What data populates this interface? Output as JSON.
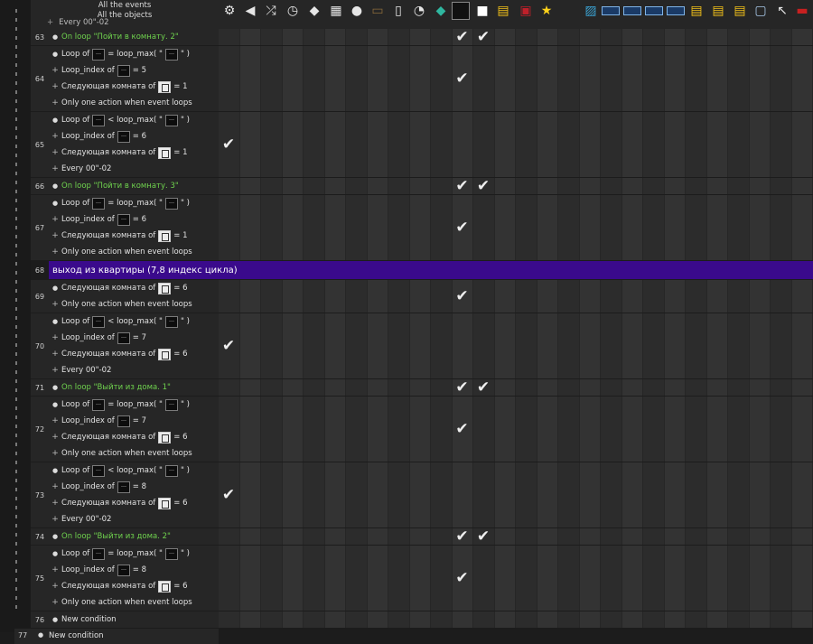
{
  "header": {
    "all_events": "All the events",
    "all_objects": "All the objects",
    "partial_row_text": "Every 00\"-02"
  },
  "icons": [
    "gears-icon",
    "speaker-icon",
    "shuffle-icon",
    "timer-icon",
    "eraser-icon",
    "keyboard-icon",
    "player-icon",
    "picture-icon",
    "door-icon",
    "clock-icon",
    "diamond-icon",
    "monitor-icon",
    "white-square-icon",
    "ini-icon",
    "save-icon",
    "star-icon",
    "landscape-icon",
    "film-icon",
    "film-icon",
    "film-icon",
    "film-icon",
    "folder-ini-icon",
    "folder-ini-icon",
    "folder-ini-icon",
    "window-icon",
    "cursor-icon",
    "red-bar-icon"
  ],
  "colors": {
    "green_text": "#6fd24e",
    "comment_bg": "#3a0a8c"
  },
  "rows": [
    {
      "num": "63",
      "lines": [
        {
          "m": "dot",
          "t": "On loop \"Пойти в комнату. 2\"",
          "green": true
        }
      ],
      "checks": [
        11,
        12
      ]
    },
    {
      "num": "64",
      "lines": [
        {
          "m": "dot",
          "t": "Loop of",
          "chip": "obj",
          "t2": "= loop_max( \"",
          "chip2": "obj",
          "t3": "\" )"
        },
        {
          "m": "plus",
          "t": "Loop_index of",
          "chip": "obj",
          "t2": "= 5"
        },
        {
          "m": "plus",
          "t": "Следующая комната of",
          "chip": "door",
          "t2": "= 1"
        },
        {
          "m": "plus",
          "t": "Only one action when event loops"
        }
      ],
      "checks": [
        11
      ]
    },
    {
      "num": "65",
      "lines": [
        {
          "m": "dot",
          "t": "Loop of",
          "chip": "obj",
          "t2": "< loop_max( \"",
          "chip2": "obj",
          "t3": "\" )"
        },
        {
          "m": "plus",
          "t": "Loop_index of",
          "chip": "obj",
          "t2": "= 6"
        },
        {
          "m": "plus",
          "t": "Следующая комната of",
          "chip": "door",
          "t2": "= 1"
        },
        {
          "m": "plus",
          "t": "Every 00\"-02"
        }
      ],
      "checks": [
        0
      ]
    },
    {
      "num": "66",
      "lines": [
        {
          "m": "dot",
          "t": "On loop \"Пойти в комнату. 3\"",
          "green": true
        }
      ],
      "checks": [
        11,
        12
      ]
    },
    {
      "num": "67",
      "lines": [
        {
          "m": "dot",
          "t": "Loop of",
          "chip": "obj",
          "t2": "= loop_max( \"",
          "chip2": "obj",
          "t3": "\" )"
        },
        {
          "m": "plus",
          "t": "Loop_index of",
          "chip": "obj",
          "t2": "= 6"
        },
        {
          "m": "plus",
          "t": "Следующая комната of",
          "chip": "door",
          "t2": "= 1"
        },
        {
          "m": "plus",
          "t": "Only one action when event loops"
        }
      ],
      "checks": [
        11
      ]
    },
    {
      "num": "68",
      "comment": "выход из квартиры (7,8 индекс цикла)"
    },
    {
      "num": "69",
      "lines": [
        {
          "m": "dot",
          "t": "Следующая комната of",
          "chip": "door",
          "t2": "= 6"
        },
        {
          "m": "plus",
          "t": "Only one action when event loops"
        }
      ],
      "checks": [
        11
      ]
    },
    {
      "num": "70",
      "lines": [
        {
          "m": "dot",
          "t": "Loop of",
          "chip": "obj",
          "t2": "< loop_max( \"",
          "chip2": "obj",
          "t3": "\" )"
        },
        {
          "m": "plus",
          "t": "Loop_index of",
          "chip": "obj",
          "t2": "= 7"
        },
        {
          "m": "plus",
          "t": "Следующая комната of",
          "chip": "door",
          "t2": "= 6"
        },
        {
          "m": "plus",
          "t": "Every 00\"-02"
        }
      ],
      "checks": [
        0
      ]
    },
    {
      "num": "71",
      "lines": [
        {
          "m": "dot",
          "t": "On loop \"Выйти из дома. 1\"",
          "green": true
        }
      ],
      "checks": [
        11,
        12
      ]
    },
    {
      "num": "72",
      "lines": [
        {
          "m": "dot",
          "t": "Loop of",
          "chip": "obj",
          "t2": "= loop_max( \"",
          "chip2": "obj",
          "t3": "\" )"
        },
        {
          "m": "plus",
          "t": "Loop_index of",
          "chip": "obj",
          "t2": "= 7"
        },
        {
          "m": "plus",
          "t": "Следующая комната of",
          "chip": "door",
          "t2": "= 6"
        },
        {
          "m": "plus",
          "t": "Only one action when event loops"
        }
      ],
      "checks": [
        11
      ]
    },
    {
      "num": "73",
      "lines": [
        {
          "m": "dot",
          "t": "Loop of",
          "chip": "obj",
          "t2": "< loop_max( \"",
          "chip2": "obj",
          "t3": "\" )"
        },
        {
          "m": "plus",
          "t": "Loop_index of",
          "chip": "obj",
          "t2": "= 8"
        },
        {
          "m": "plus",
          "t": "Следующая комната of",
          "chip": "door",
          "t2": "= 6"
        },
        {
          "m": "plus",
          "t": "Every 00\"-02"
        }
      ],
      "checks": [
        0
      ]
    },
    {
      "num": "74",
      "lines": [
        {
          "m": "dot",
          "t": "On loop \"Выйти из дома. 2\"",
          "green": true
        }
      ],
      "checks": [
        11,
        12
      ]
    },
    {
      "num": "75",
      "lines": [
        {
          "m": "dot",
          "t": "Loop of",
          "chip": "obj",
          "t2": "= loop_max( \"",
          "chip2": "obj",
          "t3": "\" )"
        },
        {
          "m": "plus",
          "t": "Loop_index of",
          "chip": "obj",
          "t2": "= 8"
        },
        {
          "m": "plus",
          "t": "Следующая комната of",
          "chip": "door",
          "t2": "= 6"
        },
        {
          "m": "plus",
          "t": "Only one action when event loops"
        }
      ],
      "checks": [
        11
      ]
    },
    {
      "num": "76",
      "lines": [
        {
          "m": "dot",
          "t": "New condition"
        }
      ],
      "checks": []
    }
  ],
  "bottom_row": {
    "num": "77",
    "text": "New condition"
  }
}
